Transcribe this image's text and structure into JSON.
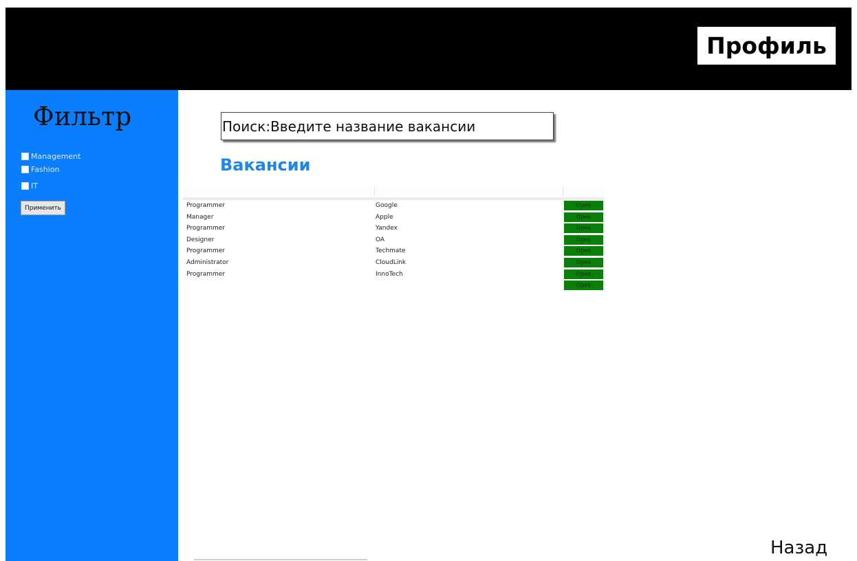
{
  "header": {
    "profile_label": "Профиль"
  },
  "sidebar": {
    "title": "Фильтр",
    "filters": [
      "Management",
      "Fashion",
      "IT"
    ],
    "apply_label": "Применить"
  },
  "search": {
    "placeholder": "Поиск:Введите название вакансии"
  },
  "vacancies": {
    "title": "Вакансии",
    "open_label": "Open",
    "rows": [
      {
        "position": "Programmer",
        "company": "Google"
      },
      {
        "position": "Manager",
        "company": "Apple"
      },
      {
        "position": "Programmer",
        "company": "Yandex"
      },
      {
        "position": "Designer",
        "company": "OA"
      },
      {
        "position": "Programmer",
        "company": "Techmate"
      },
      {
        "position": "Administrator",
        "company": "CloudLink"
      },
      {
        "position": "Programmer",
        "company": "InnoTech"
      },
      {
        "position": "",
        "company": ""
      }
    ]
  },
  "footer": {
    "back_label": "Назад"
  },
  "colors": {
    "sidebar": "#0a7eff",
    "header": "#000000",
    "open_button": "#0a7f0a",
    "title": "#1f86e6"
  }
}
